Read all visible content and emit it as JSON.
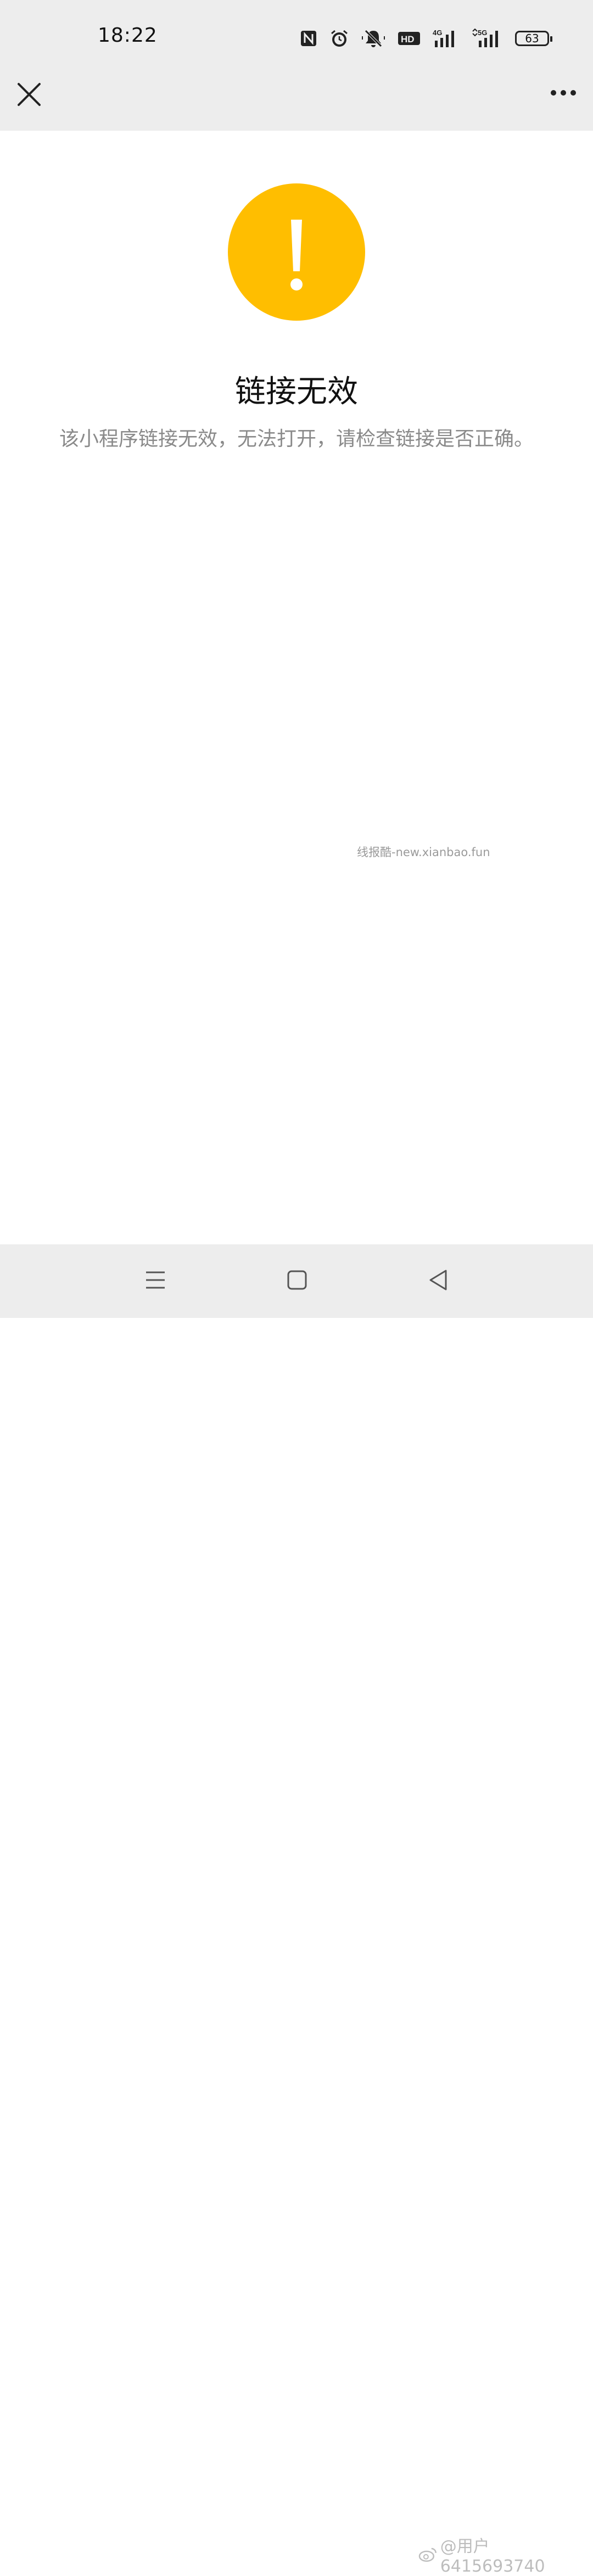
{
  "status_bar": {
    "time": "18:22",
    "icons": [
      "nfc-icon",
      "alarm-icon",
      "mute-icon",
      "hd-icon",
      "4g-signal-icon",
      "5g-signal-icon"
    ],
    "battery": "63"
  },
  "nav": {
    "close_icon": "close-icon",
    "more_icon": "more-icon"
  },
  "error": {
    "icon": "warning-icon",
    "icon_color": "#ffbe00",
    "title": "链接无效",
    "description": "该小程序链接无效，无法打开，请检查链接是否正确。"
  },
  "watermarks": {
    "site": "线报酷-new.xianbao.fun",
    "user": "@用户6415693740"
  },
  "bottom_nav": {
    "items": [
      "menu-icon",
      "home-icon",
      "back-icon"
    ]
  }
}
